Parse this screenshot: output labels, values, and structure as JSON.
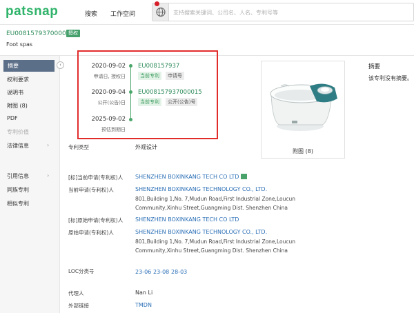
{
  "header": {
    "logo": "patsnap",
    "nav": [
      "搜索",
      "工作空间"
    ],
    "search_placeholder": "支持搜索关键词、公司名、人名、专利号等"
  },
  "patent": {
    "id": "EU008157937000015",
    "status_badge": "授权",
    "title": "Foot spas"
  },
  "sidebar": {
    "items": [
      "摘要",
      "权利要求",
      "说明书",
      "附图 (8)",
      "PDF",
      "专利价值",
      "法律信息",
      "引用信息",
      "同族专利",
      "相似专利"
    ]
  },
  "timeline": [
    {
      "date": "2020-09-02",
      "label": "申请日, 授权日",
      "number": "EU008157937",
      "tags": [
        "当前专利",
        "申请号"
      ]
    },
    {
      "date": "2020-09-04",
      "label": "公开(公告)日",
      "number": "EU008157937000015",
      "tags": [
        "当前专利",
        "公开(公告)号"
      ]
    },
    {
      "date": "2025-09-02",
      "label": "预估到期日",
      "number": "",
      "tags": []
    }
  ],
  "figure": {
    "caption": "附图 (8)"
  },
  "abstract": {
    "title": "摘要",
    "text": "该专利没有摘要。"
  },
  "fields": {
    "patent_type_label": "专利类型",
    "patent_type_value": "外观设计",
    "std_current_applicant_label": "[标]当前申请(专利权)人",
    "std_current_applicant_value": "SHENZHEN BOXINKANG TECH CO LTD",
    "current_applicant_label": "当前申请(专利权)人",
    "current_applicant_value": "SHENZHEN BOXINKANG TECHNOLOGY CO., LTD.",
    "current_applicant_addr1": "801,Building 1,No. 7,Mudun Road,First Industrial Zone,Loucun",
    "current_applicant_addr2": "Community,Xinhu Street,Guangming Dist. Shenzhen China",
    "std_original_applicant_label": "[标]原始申请(专利权)人",
    "std_original_applicant_value": "SHENZHEN BOXINKANG TECH CO LTD",
    "original_applicant_label": "原始申请(专利权)人",
    "original_applicant_value": "SHENZHEN BOXINKANG TECHNOLOGY CO., LTD.",
    "original_applicant_addr1": "801,Building 1,No. 7,Mudun Road,First Industrial Zone,Loucun",
    "original_applicant_addr2": "Community,Xinhu Street,Guangming Dist. Shenzhen China",
    "loc_label": "LOC分类号",
    "loc_values": [
      "23-06",
      "23-08",
      "28-03"
    ],
    "agent_label": "代理人",
    "agent_value": "Nan Li",
    "external_link_label": "外部链接",
    "external_link_value": "TMDN"
  },
  "colors": {
    "brand": "#2fb36a",
    "link": "#2b6fb6",
    "highlight_frame": "#e22c2c",
    "sidebar_active": "#5c6f88"
  }
}
